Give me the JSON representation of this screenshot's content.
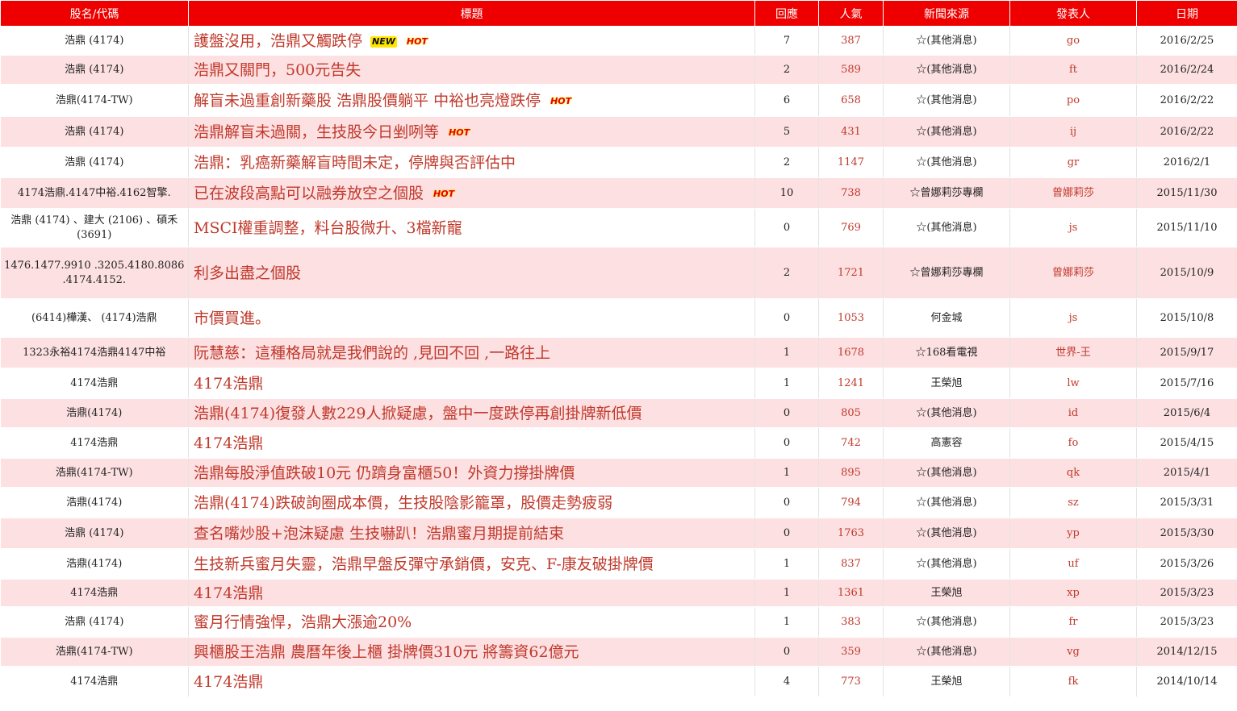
{
  "headers": {
    "stock": "股名/代碼",
    "title": "標題",
    "replies": "回應",
    "views": "人氣",
    "source": "新聞來源",
    "author": "發表人",
    "date": "日期"
  },
  "rows": [
    {
      "stock": "浩鼎 (4174)",
      "title": "護盤沒用，浩鼎又觸跌停",
      "badges": [
        "NEW",
        "HOT"
      ],
      "replies": "7",
      "views": "387",
      "source": "☆(其他消息)",
      "author": "go",
      "date": "2016/2/25"
    },
    {
      "stock": "浩鼎 (4174)",
      "title": "浩鼎又關門，500元告失",
      "badges": [],
      "replies": "2",
      "views": "589",
      "source": "☆(其他消息)",
      "author": "ft",
      "date": "2016/2/24"
    },
    {
      "stock": "浩鼎(4174-TW)",
      "title": "解盲未過重創新藥股 浩鼎股價躺平 中裕也亮燈跌停",
      "badges": [
        "HOT"
      ],
      "replies": "6",
      "views": "658",
      "source": "☆(其他消息)",
      "author": "po",
      "date": "2016/2/22"
    },
    {
      "stock": "浩鼎 (4174)",
      "title": "浩鼎解盲未過關，生技股今日剉咧等",
      "badges": [
        "HOT"
      ],
      "replies": "5",
      "views": "431",
      "source": "☆(其他消息)",
      "author": "ij",
      "date": "2016/2/22"
    },
    {
      "stock": "浩鼎 (4174)",
      "title": "浩鼎：乳癌新藥解盲時間未定，停牌與否評估中",
      "badges": [],
      "replies": "2",
      "views": "1147",
      "source": "☆(其他消息)",
      "author": "gr",
      "date": "2016/2/1"
    },
    {
      "stock": "4174浩鼎.4147中裕.4162智擎.",
      "title": "已在波段高點可以融券放空之個股",
      "badges": [
        "HOT"
      ],
      "replies": "10",
      "views": "738",
      "source": "☆曾娜莉莎專欄",
      "author": "曾娜莉莎",
      "date": "2015/11/30"
    },
    {
      "stock": "浩鼎 (4174) 、建大 (2106) 、碩禾 (3691)",
      "title": "MSCI權重調整，料台股微升、3檔新寵",
      "badges": [],
      "replies": "0",
      "views": "769",
      "source": "☆(其他消息)",
      "author": "js",
      "date": "2015/11/10"
    },
    {
      "stock": "1476.1477.9910 .3205.4180.8086 .4174.4152.",
      "title": "利多出盡之個股",
      "badges": [],
      "replies": "2",
      "views": "1721",
      "source": "☆曾娜莉莎專欄",
      "author": "曾娜莉莎",
      "date": "2015/10/9"
    },
    {
      "stock": "(6414)樺漢、 (4174)浩鼎",
      "title": "市價買進。",
      "badges": [],
      "replies": "0",
      "views": "1053",
      "source": "何金城",
      "author": "js",
      "date": "2015/10/8"
    },
    {
      "stock": "1323永裕4174浩鼎4147中裕",
      "title": "阮慧慈：這種格局就是我們說的 ,見回不回 ,一路往上",
      "badges": [],
      "replies": "1",
      "views": "1678",
      "source": "☆168看電視",
      "author": "世界-王",
      "date": "2015/9/17"
    },
    {
      "stock": "4174浩鼎",
      "title": "4174浩鼎",
      "badges": [],
      "replies": "1",
      "views": "1241",
      "source": "王榮旭",
      "author": "lw",
      "date": "2015/7/16"
    },
    {
      "stock": "浩鼎(4174)",
      "title": "浩鼎(4174)復發人數229人掀疑慮，盤中一度跌停再創掛牌新低價",
      "badges": [],
      "replies": "0",
      "views": "805",
      "source": "☆(其他消息)",
      "author": "id",
      "date": "2015/6/4"
    },
    {
      "stock": "4174浩鼎",
      "title": "4174浩鼎",
      "badges": [],
      "replies": "0",
      "views": "742",
      "source": "高憲容",
      "author": "fo",
      "date": "2015/4/15"
    },
    {
      "stock": "浩鼎(4174-TW)",
      "title": "浩鼎每股淨值跌破10元 仍躋身富櫃50！外資力撐掛牌價",
      "badges": [],
      "replies": "1",
      "views": "895",
      "source": "☆(其他消息)",
      "author": "qk",
      "date": "2015/4/1"
    },
    {
      "stock": "浩鼎(4174)",
      "title": "浩鼎(4174)跌破詢圈成本價，生技股陰影籠罩，股價走勢疲弱",
      "badges": [],
      "replies": "0",
      "views": "794",
      "source": "☆(其他消息)",
      "author": "sz",
      "date": "2015/3/31"
    },
    {
      "stock": "浩鼎 (4174)",
      "title": "查名嘴炒股+泡沫疑慮 生技嚇趴！浩鼎蜜月期提前結束",
      "badges": [],
      "replies": "0",
      "views": "1763",
      "source": "☆(其他消息)",
      "author": "yp",
      "date": "2015/3/30"
    },
    {
      "stock": "浩鼎(4174)",
      "title": "生技新兵蜜月失靈，浩鼎早盤反彈守承銷價，安克、F-康友破掛牌價",
      "badges": [],
      "replies": "1",
      "views": "837",
      "source": "☆(其他消息)",
      "author": "uf",
      "date": "2015/3/26"
    },
    {
      "stock": "4174浩鼎",
      "title": "4174浩鼎",
      "badges": [],
      "replies": "1",
      "views": "1361",
      "source": "王榮旭",
      "author": "xp",
      "date": "2015/3/23"
    },
    {
      "stock": "浩鼎 (4174)",
      "title": "蜜月行情強悍，浩鼎大漲逾20%",
      "badges": [],
      "replies": "1",
      "views": "383",
      "source": "☆(其他消息)",
      "author": "fr",
      "date": "2015/3/23"
    },
    {
      "stock": "浩鼎(4174-TW)",
      "title": "興櫃股王浩鼎 農曆年後上櫃 掛牌價310元 將籌資62億元",
      "badges": [],
      "replies": "0",
      "views": "359",
      "source": "☆(其他消息)",
      "author": "vg",
      "date": "2014/12/15"
    },
    {
      "stock": "4174浩鼎",
      "title": "4174浩鼎",
      "badges": [],
      "replies": "4",
      "views": "773",
      "source": "王榮旭",
      "author": "fk",
      "date": "2014/10/14"
    }
  ],
  "colors": {
    "header_bg": "#ee0000",
    "row_alt_bg": "#fde0e2",
    "link": "#c0392b"
  }
}
